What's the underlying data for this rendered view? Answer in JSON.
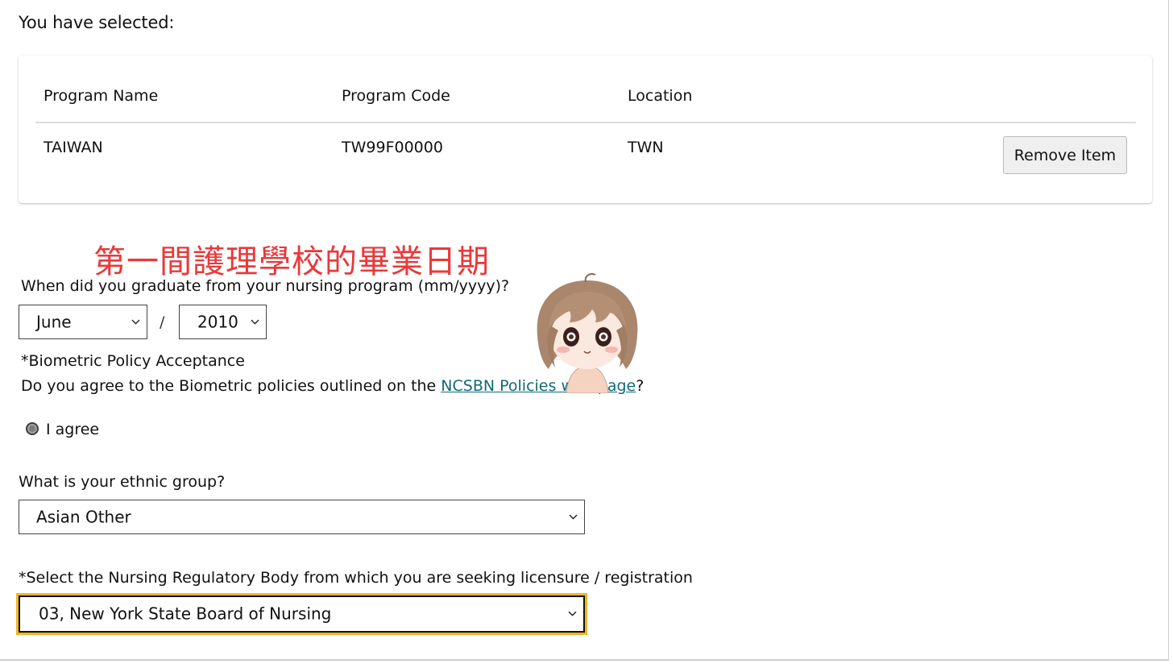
{
  "selection": {
    "heading": "You have selected:",
    "columns": [
      "Program Name",
      "Program Code",
      "Location"
    ],
    "row": {
      "program_name": "TAIWAN",
      "program_code": "TW99F00000",
      "location": "TWN"
    },
    "remove_label": "Remove Item"
  },
  "annotation": {
    "text": "第一間護理學校的畢業日期",
    "color": "#e8393a"
  },
  "graduation": {
    "question": "When did you graduate from your nursing program (mm/yyyy)?",
    "month": "June",
    "separator": "/",
    "year": "2010"
  },
  "biometric": {
    "title": "*Biometric Policy Acceptance",
    "question_prefix": "Do you agree to the Biometric policies outlined on the ",
    "link_text": "NCSBN Policies web page",
    "question_suffix": "?",
    "link_color": "#0f6a78",
    "option_label": "I agree"
  },
  "ethnicity": {
    "question": "What is your ethnic group?",
    "value": "Asian Other"
  },
  "regulatory": {
    "question": "*Select the Nursing Regulatory Body from which you are seeking licensure / registration",
    "value": "03, New York State Board of Nursing",
    "focus_color": "#f0b429"
  },
  "icons": {
    "dropdown": "chevron-down-icon",
    "sticker": "chibi-girl-sticker"
  }
}
